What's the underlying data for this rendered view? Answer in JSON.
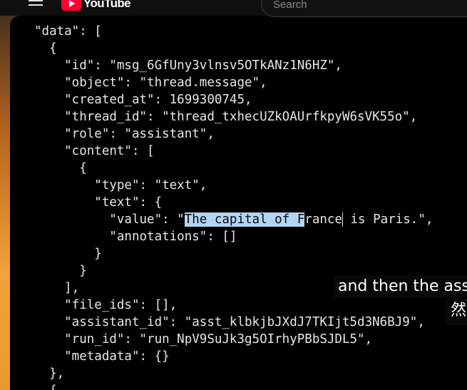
{
  "youtube_bar": {
    "logo_text": "YouTube",
    "search_placeholder": "Search"
  },
  "code": {
    "lines": [
      "\"data\": [",
      "  {",
      "    \"id\": \"msg_6GfUny3vlnsv5OTkANz1N6HZ\",",
      "    \"object\": \"thread.message\",",
      "    \"created_at\": 1699300745,",
      "    \"thread_id\": \"thread_txhecUZkOAUrfkpyW6sVK55o\",",
      "    \"role\": \"assistant\",",
      "    \"content\": [",
      "      {",
      "        \"type\": \"text\",",
      "        \"text\": {",
      "          \"value\": \"The capital of France is Paris.\",",
      "          \"annotations\": []",
      "        }",
      "      }",
      "    ],",
      "    \"file_ids\": [],",
      "    \"assistant_id\": \"asst_klbkjbJXdJ7TKIjt5d3N6BJ9\",",
      "    \"run_id\": \"run_NpV9SuJk3g5OIrhyPBbSJDL5\",",
      "    \"metadata\": {}",
      "  },",
      "  {"
    ],
    "selected_line": {
      "prefix": "          \"value\": \"",
      "selected": "The capital of F",
      "before_caret": "rance",
      "after_caret": " is Paris.\","
    }
  },
  "captions": {
    "english": "and then the assi",
    "chinese": "然"
  },
  "colors": {
    "selection": "#b3d4f3",
    "editor_bg": "#000000",
    "text": "#e6e6e6",
    "youtube_red": "#ff0033"
  }
}
